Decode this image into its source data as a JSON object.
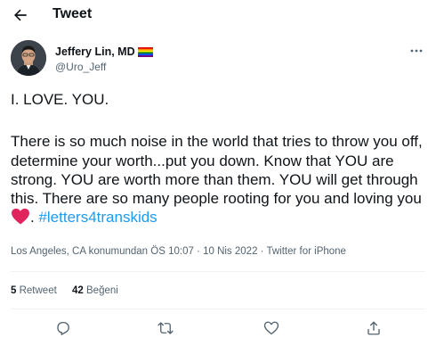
{
  "header": {
    "title": "Tweet"
  },
  "author": {
    "name": "Jeffery Lin, MD",
    "handle": "@Uro_Jeff"
  },
  "tweet": {
    "line1": "I. LOVE. YOU.",
    "body": "There is so much noise in the world that tries to throw you off, determine your worth...put you down. Know that YOU are strong. YOU are worth more than them. YOU will get through this. There are so many people rooting for you and loving you",
    "after_heart": ". ",
    "hashtag": "#letters4transkids"
  },
  "meta": {
    "text": "Los Angeles, CA konumundan ÖS 10:07 · 10 Nis 2022 · Twitter for iPhone"
  },
  "stats": {
    "retweets_count": "5",
    "retweets_label": "Retweet",
    "likes_count": "42",
    "likes_label": "Beğeni"
  },
  "icons": {
    "back": "arrow-left-icon",
    "more": "more-horizontal-icon",
    "flag": "rainbow-flag-icon",
    "heart": "red-heart-icon",
    "reply": "reply-icon",
    "retweet": "retweet-icon",
    "like": "like-icon",
    "share": "share-icon"
  },
  "colors": {
    "accent": "#1d9bf0",
    "text": "#0f1419",
    "muted": "#536471",
    "heart": "#e0245e"
  }
}
